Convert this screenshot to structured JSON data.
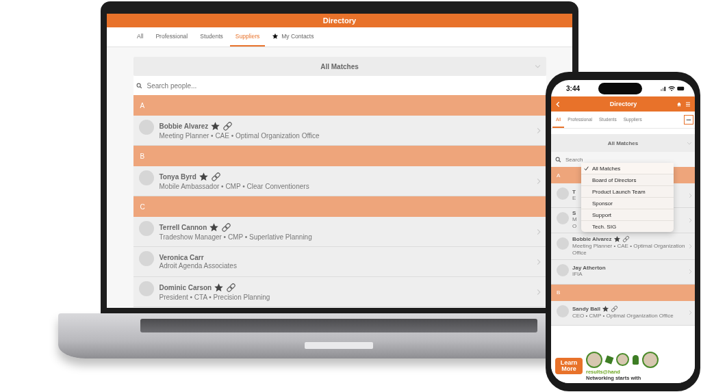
{
  "laptop": {
    "title": "Directory",
    "tabs": [
      {
        "label": "All",
        "selected": false,
        "kind": "plain"
      },
      {
        "label": "Professional",
        "selected": false,
        "kind": "plain"
      },
      {
        "label": "Students",
        "selected": false,
        "kind": "plain"
      },
      {
        "label": "Suppliers",
        "selected": true,
        "kind": "plain"
      },
      {
        "label": "My Contacts",
        "selected": false,
        "kind": "starred"
      }
    ],
    "filter": {
      "label": "All Matches"
    },
    "search": {
      "placeholder": "Search people..."
    },
    "sections": [
      {
        "letter": "A",
        "people": [
          {
            "name": "Bobbie Alvarez",
            "subtitle": "Meeting Planner • CAE • Optimal Organization Office",
            "favorite": true,
            "linked": true
          }
        ]
      },
      {
        "letter": "B",
        "people": [
          {
            "name": "Tonya Byrd",
            "subtitle": "Mobile Ambassador • CMP • Clear Conventioners",
            "favorite": true,
            "linked": true
          }
        ]
      },
      {
        "letter": "C",
        "people": [
          {
            "name": "Terrell Cannon",
            "subtitle": "Tradeshow Manager • CMP • Superlative Planning",
            "favorite": true,
            "linked": true
          },
          {
            "name": "Veronica Carr",
            "subtitle": "Adroit Agenda Associates",
            "favorite": false,
            "linked": false
          },
          {
            "name": "Dominic Carson",
            "subtitle": "President • CTA • Precision Planning",
            "favorite": true,
            "linked": true
          }
        ]
      }
    ]
  },
  "phone": {
    "time": "3:44",
    "title": "Directory",
    "tabs": [
      {
        "label": "All",
        "selected": true
      },
      {
        "label": "Professional",
        "selected": false
      },
      {
        "label": "Students",
        "selected": false
      },
      {
        "label": "Suppliers",
        "selected": false
      }
    ],
    "more_button": "•••",
    "filter": {
      "label": "All Matches"
    },
    "search": {
      "placeholder": "Search"
    },
    "dropdown": [
      {
        "label": "All Matches",
        "selected": true
      },
      {
        "label": "Board of Directors",
        "selected": false
      },
      {
        "label": "Product Launch Team",
        "selected": false
      },
      {
        "label": "Sponsor",
        "selected": false
      },
      {
        "label": "Support",
        "selected": false
      },
      {
        "label": "Tech. SIG",
        "selected": false
      }
    ],
    "sections": [
      {
        "letter": "A",
        "people": [
          {
            "name": "T",
            "subtitle": "E",
            "favorite": false,
            "linked": false
          },
          {
            "name": "S",
            "subtitle": "M\nO",
            "favorite": false,
            "linked": false
          },
          {
            "name": "Bobbie Alvarez",
            "subtitle": "Meeting Planner • CAE • Optimal Organization Office",
            "favorite": true,
            "linked": true
          },
          {
            "name": "Jay Atherton",
            "subtitle": "IFIA",
            "favorite": false,
            "linked": false
          }
        ]
      },
      {
        "letter": "B",
        "people": [
          {
            "name": "Sandy Ball",
            "subtitle": "CEO • CMP • Optimal Organization Office",
            "favorite": true,
            "linked": true
          }
        ]
      }
    ],
    "ad": {
      "button": "Learn More",
      "logo": "results@hand",
      "tagline": "Networking starts with"
    }
  }
}
